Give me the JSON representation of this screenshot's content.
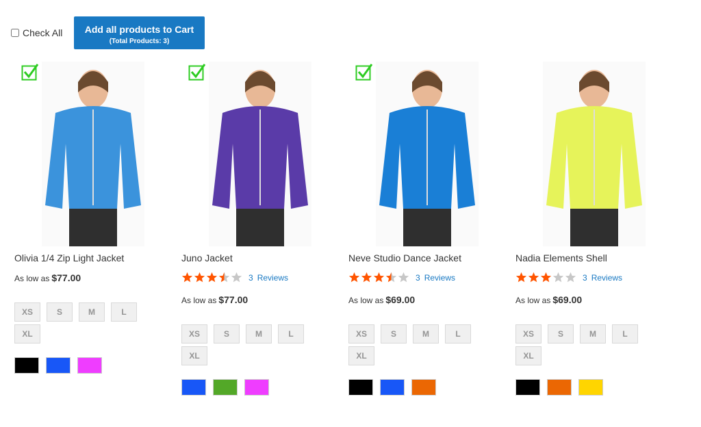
{
  "header": {
    "check_all_label": "Check All",
    "add_all_button": "Add all products to Cart",
    "add_all_sub": "(Total Products: 3)"
  },
  "products": [
    {
      "name": "Olivia 1/4 Zip Light Jacket",
      "checked": true,
      "has_rating": false,
      "price_prefix": "As low as",
      "price": "$77.00",
      "sizes": [
        "XS",
        "S",
        "M",
        "L",
        "XL"
      ],
      "colors": [
        "#000000",
        "#1857f7",
        "#ef3dff"
      ],
      "jacket_color": "#3b93dc"
    },
    {
      "name": "Juno Jacket",
      "checked": true,
      "has_rating": true,
      "rating": 3.5,
      "review_count": "3",
      "review_label": "Reviews",
      "price_prefix": "As low as",
      "price": "$77.00",
      "sizes": [
        "XS",
        "S",
        "M",
        "L",
        "XL"
      ],
      "colors": [
        "#1857f7",
        "#53a828",
        "#ef3dff"
      ],
      "jacket_color": "#5a3ba8"
    },
    {
      "name": "Neve Studio Dance Jacket",
      "checked": true,
      "has_rating": true,
      "rating": 3.5,
      "review_count": "3",
      "review_label": "Reviews",
      "price_prefix": "As low as",
      "price": "$69.00",
      "sizes": [
        "XS",
        "S",
        "M",
        "L",
        "XL"
      ],
      "colors": [
        "#000000",
        "#1857f7",
        "#eb6703"
      ],
      "jacket_color": "#1a7fd6"
    },
    {
      "name": "Nadia Elements Shell",
      "checked": false,
      "has_rating": true,
      "rating": 3,
      "review_count": "3",
      "review_label": "Reviews",
      "price_prefix": "As low as",
      "price": "$69.00",
      "sizes": [
        "XS",
        "S",
        "M",
        "L",
        "XL"
      ],
      "colors": [
        "#000000",
        "#eb6703",
        "#ffd500"
      ],
      "jacket_color": "#e6f35a"
    }
  ],
  "colors": {
    "primary": "#1979c3",
    "star_filled": "#ff5501",
    "star_empty": "#c7c7c7",
    "check": "#2ecc22"
  }
}
